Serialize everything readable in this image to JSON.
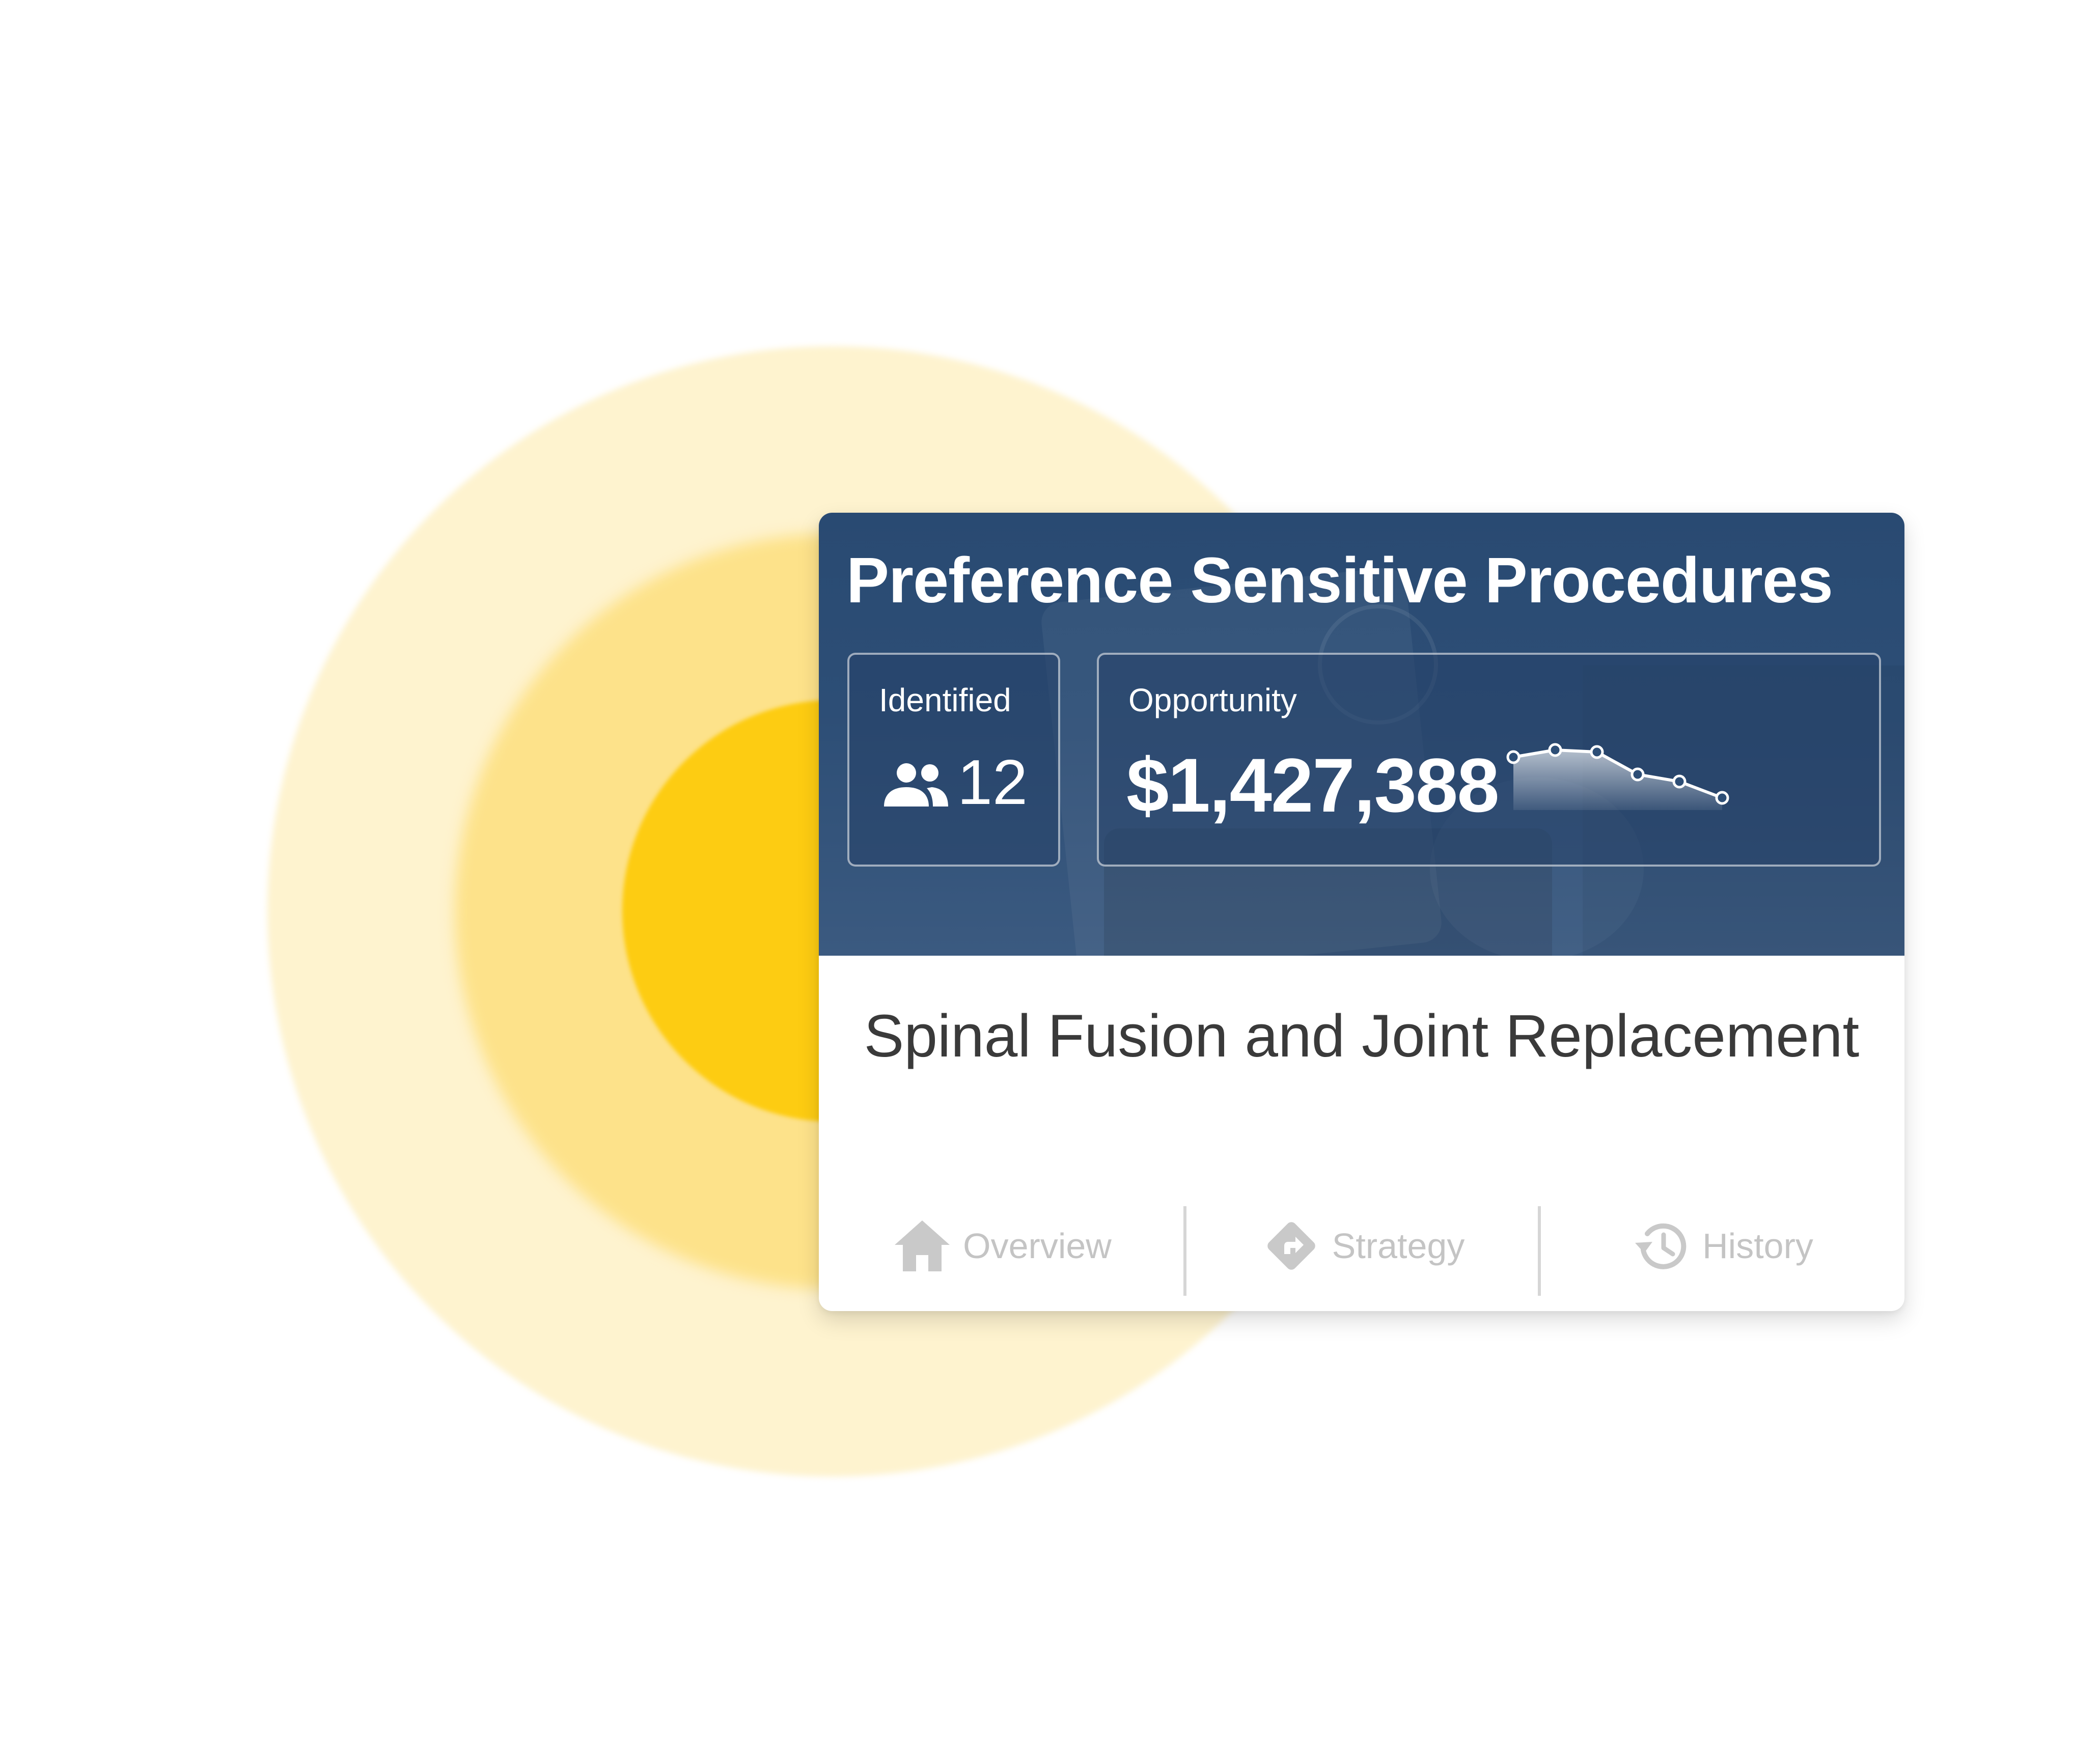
{
  "card": {
    "title": "Preference Sensitive Procedures",
    "subtitle": "Spinal Fusion and Joint Replacement",
    "identified": {
      "label": "Identified",
      "icon": "people-icon",
      "value": "12"
    },
    "opportunity": {
      "label": "Opportunity",
      "value": "$1,427,388",
      "trend_icon": "sparkline-trend"
    },
    "tabs": [
      {
        "label": "Overview",
        "icon": "home-icon"
      },
      {
        "label": "Strategy",
        "icon": "directions-icon"
      },
      {
        "label": "History",
        "icon": "history-icon"
      }
    ]
  },
  "colors": {
    "header_navy": "#2d4e76",
    "glow_yellow": "#fdcc12",
    "glow_light": "#fde28a",
    "glow_pale": "#fef3cf",
    "tab_text": "#c4c4c4",
    "subtitle_text": "#3a3a3a"
  }
}
